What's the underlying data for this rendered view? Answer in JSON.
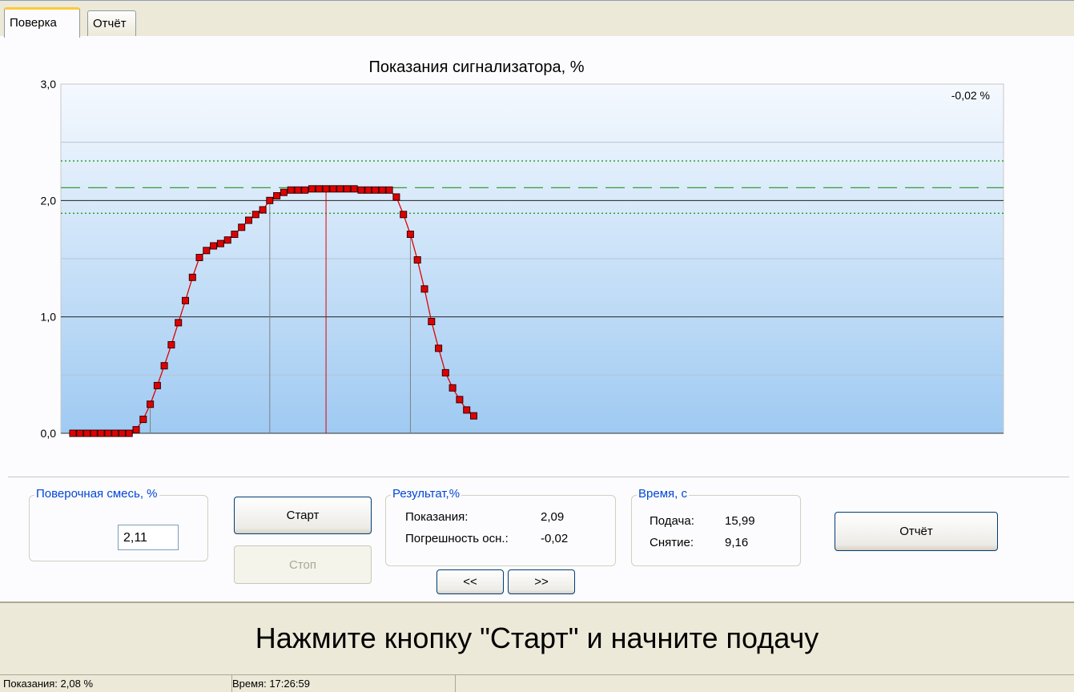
{
  "tabs": [
    {
      "label": "Поверка",
      "active": true
    },
    {
      "label": "Отчёт",
      "active": false
    }
  ],
  "chart_title": "Показания сигнализатора, %",
  "chart_data": {
    "type": "line",
    "title": "Показания сигнализатора, %",
    "ylim": [
      0,
      3
    ],
    "y_ticks": [
      "0,0",
      "1,0",
      "2,0",
      "3,0"
    ],
    "annotation": "-0,02 %",
    "reference_line": 2.11,
    "tolerance_band": [
      1.89,
      2.34
    ],
    "marker_color": "#e00000",
    "line_color": "#e00000",
    "grid": true,
    "x": [
      0,
      1,
      2,
      3,
      4,
      5,
      6,
      7,
      8,
      9,
      10,
      11,
      12,
      13,
      14,
      15,
      16,
      17,
      18,
      19,
      20,
      21,
      22,
      23,
      24,
      25,
      26,
      27,
      28,
      29,
      30,
      31,
      32,
      33,
      34,
      35,
      36,
      37,
      38,
      39,
      40,
      41,
      42,
      43,
      44,
      45,
      46,
      47,
      48,
      49,
      50,
      51,
      52,
      53,
      54,
      55,
      56,
      57,
      58,
      59,
      60,
      61,
      62,
      63,
      64,
      65,
      66,
      67,
      68,
      69,
      70,
      71,
      72,
      73,
      74,
      75,
      76,
      77,
      78,
      79,
      80,
      81,
      82
    ],
    "values": [
      0,
      0,
      0,
      0,
      0,
      0,
      0,
      0,
      0,
      0.03,
      0.12,
      0.25,
      0.41,
      0.58,
      0.76,
      0.95,
      1.14,
      1.34,
      1.51,
      1.57,
      1.61,
      1.63,
      1.66,
      1.71,
      1.77,
      1.83,
      1.88,
      1.92,
      2.0,
      2.04,
      2.07,
      2.09,
      2.09,
      2.09,
      2.1,
      2.1,
      2.1,
      2.1,
      2.1,
      2.1,
      2.1,
      2.09,
      2.09,
      2.09,
      2.09,
      2.09,
      2.03,
      1.88,
      1.71,
      1.49,
      1.24,
      0.96,
      0.73,
      0.52,
      0.39,
      0.29,
      0.2,
      0.15
    ],
    "vertical_markers": [
      1.0,
      0,
      0,
      0
    ]
  },
  "verify_mix": {
    "title": "Поверочная смесь, %",
    "value": "2,11"
  },
  "buttons": {
    "start": "Старт",
    "stop": "Стоп",
    "prev": "<<",
    "next": ">>",
    "report": "Отчёт"
  },
  "result": {
    "title": "Результат,%",
    "reading_label": "Показания:",
    "reading_value": "2,09",
    "error_label": "Погрешность осн.:",
    "error_value": "-0,02"
  },
  "time": {
    "title": "Время, с",
    "supply_label": "Подача:",
    "supply_value": "15,99",
    "removal_label": "Снятие:",
    "removal_value": "9,16"
  },
  "message": "Нажмите кнопку \"Старт\" и начните подачу",
  "status": {
    "readings": "Показания: 2,08 %",
    "time": "Время: 17:26:59"
  }
}
